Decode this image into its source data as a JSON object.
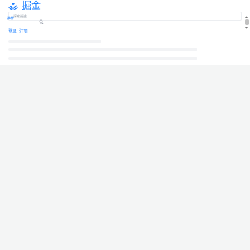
{
  "header": {
    "logo_text": "掘金",
    "logo_icon": "juejin-logo-icon",
    "brand_color": "#1e80ff"
  },
  "nav": {
    "item_label": "推荐"
  },
  "search": {
    "placeholder": "探索掘金",
    "icon": "search-icon"
  },
  "auth": {
    "login_label": "登录",
    "separator": "·",
    "register_label": "注册"
  },
  "colors": {
    "background": "#ffffff",
    "content_background": "#f4f5f5",
    "skeleton": "#f2f3f5"
  }
}
